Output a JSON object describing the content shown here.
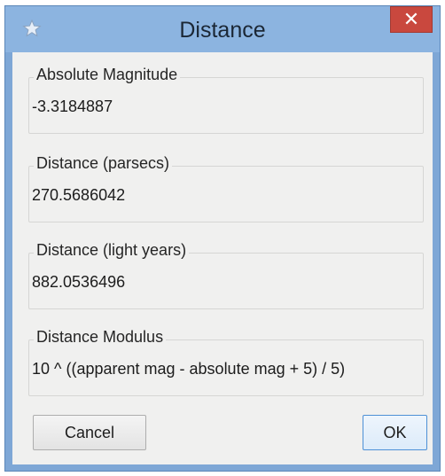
{
  "window": {
    "title": "Distance",
    "app_icon": "star-icon",
    "close_icon": "close-icon",
    "close_glyph": "✕"
  },
  "fields": [
    {
      "label": "Absolute Magnitude",
      "value": "-3.3184887"
    },
    {
      "label": "Distance (parsecs)",
      "value": "270.5686042"
    },
    {
      "label": "Distance (light years)",
      "value": "882.0536496"
    },
    {
      "label": "Distance Modulus",
      "value": "10 ^ ((apparent mag - absolute mag + 5) / 5)"
    }
  ],
  "buttons": {
    "cancel_label": "Cancel",
    "ok_label": "OK"
  }
}
